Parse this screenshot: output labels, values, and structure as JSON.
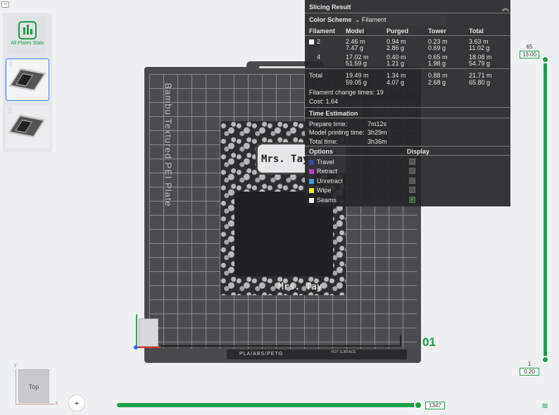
{
  "sidebar": {
    "stats_label": "All Plates Stats",
    "plates": [
      {
        "number": "1"
      },
      {
        "number": "2"
      }
    ]
  },
  "plate": {
    "brand": "Bambu Textured PEI Plate",
    "strip_text": "PLA/ABS/PETG",
    "strip_text2": "HOT SURFACE",
    "index": "01"
  },
  "model": {
    "name_top": "Mrs. Tay",
    "name_bottom": "Mrs. Tay"
  },
  "slicing": {
    "title": "Slicing Result",
    "color_scheme_label": "Color Scheme",
    "color_scheme_value": "Filament",
    "columns": [
      "Filament",
      "Model",
      "Purged",
      "Tower",
      "Total"
    ],
    "filaments": [
      {
        "id": "2",
        "color": "#ffffff",
        "model_m": "2.46 m",
        "model_g": "7.47 g",
        "purged_m": "0.94 m",
        "purged_g": "2.86 g",
        "tower_m": "0.23 m",
        "tower_g": "0.69 g",
        "total_m": "3.63 m",
        "total_g": "11.02 g"
      },
      {
        "id": "4",
        "color": "#333333",
        "model_m": "17.02 m",
        "model_g": "51.59 g",
        "purged_m": "0.40 m",
        "purged_g": "1.21 g",
        "tower_m": "0.65 m",
        "tower_g": "1.98 g",
        "total_m": "18.08 m",
        "total_g": "54.79 g"
      }
    ],
    "total": {
      "label": "Total",
      "model_m": "19.49 m",
      "model_g": "59.05 g",
      "purged_m": "1.34 m",
      "purged_g": "4.07 g",
      "tower_m": "0.88 m",
      "tower_g": "2.68 g",
      "total_m": "21.71 m",
      "total_g": "65.80 g"
    },
    "filament_change": "Filament change times:",
    "filament_change_value": "19",
    "cost_label": "Cost:",
    "cost_value": "1.64",
    "time_title": "Time Estimation",
    "prepare_label": "Prepare time:",
    "prepare_value": "7m12s",
    "model_time_label": "Model printing time:",
    "model_time_value": "3h29m",
    "total_time_label": "Total time:",
    "total_time_value": "3h36m",
    "options_label": "Options",
    "display_label": "Display",
    "options": [
      {
        "label": "Travel",
        "color": "#3a4aa8",
        "checked": false
      },
      {
        "label": "Retract",
        "color": "#c03ac0",
        "checked": false
      },
      {
        "label": "Unretract",
        "color": "#3aa0d0",
        "checked": false
      },
      {
        "label": "Wipe",
        "color": "#e8e820",
        "checked": false
      },
      {
        "label": "Seams",
        "color": "#f0f0f0",
        "checked": true
      }
    ]
  },
  "layer_slider": {
    "top_layer": "65",
    "top_height": "13.00",
    "bottom_layer": "1",
    "bottom_height": "0.20"
  },
  "move_slider": {
    "value": "1347"
  },
  "view": {
    "cube_label": "Top",
    "axis_y": "y",
    "axis_x": "x"
  },
  "colors": {
    "accent": "#1a9e48"
  }
}
